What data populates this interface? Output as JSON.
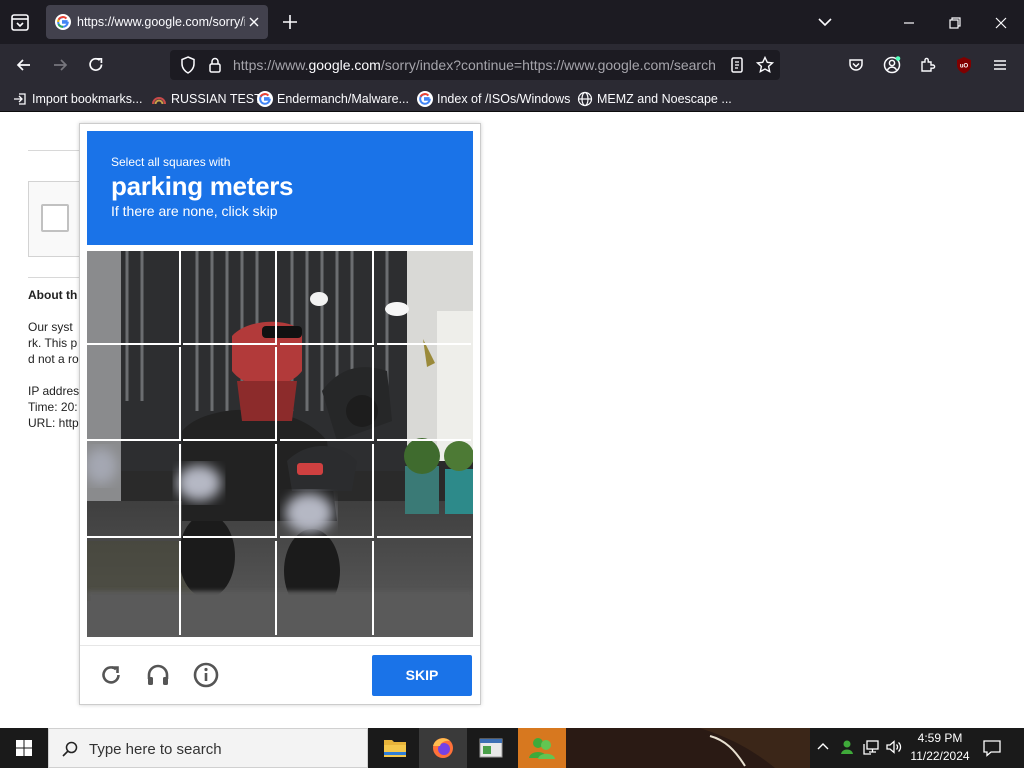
{
  "browser": {
    "tab_title": "https://www.google.com/sorry/index?continue=https://www.google.com/search",
    "url_prefix": "https://www.",
    "url_domain": "google.com",
    "url_rest": "/sorry/index?continue=https://www.google.com/search",
    "bookmarks": [
      {
        "label": "Import bookmarks...",
        "icon": "import-icon"
      },
      {
        "label": "RUSSIAN TEST",
        "icon": "rainbow-favicon-icon"
      },
      {
        "label": "Endermanch/Malware...",
        "icon": "google-favicon-icon"
      },
      {
        "label": "Index of /ISOs/Windows",
        "icon": "google-favicon-icon"
      },
      {
        "label": "MEMZ and Noescape ...",
        "icon": "globe-icon"
      }
    ]
  },
  "page": {
    "about_title": "About th",
    "about_lines": [
      "Our syst",
      "rk. This p",
      "d not a ro",
      "",
      "IP addres",
      "Time: 20:",
      "URL: http"
    ]
  },
  "captcha": {
    "instruction": "Select all squares with",
    "target": "parking meters",
    "hint": "If there are none, click skip",
    "skip_label": "SKIP",
    "grid_size": "4x4",
    "tiles_selected": 0
  },
  "taskbar": {
    "search_placeholder": "Type here to search",
    "time": "4:59 PM",
    "date": "11/22/2024"
  },
  "colors": {
    "captcha_blue": "#1a73e8",
    "tab_bar": "#1c1b22",
    "nav_bar": "#2b2a33"
  }
}
